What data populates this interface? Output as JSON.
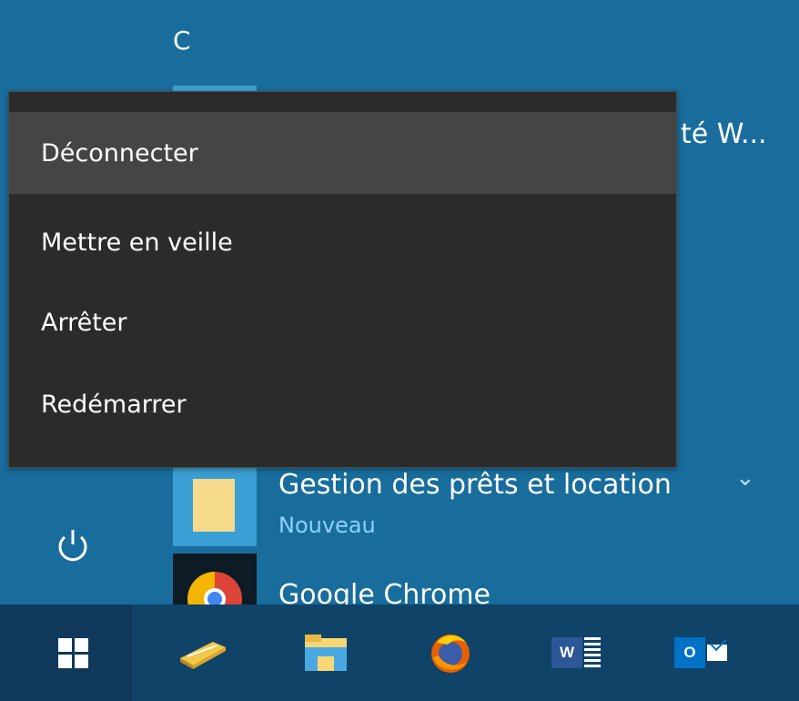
{
  "app_list": {
    "section_letter": "C",
    "truncated_item_text": "té W...",
    "apps": [
      {
        "name": "Gestion des prêts et location",
        "badge": "Nouveau",
        "icon": "document-icon",
        "expand_icon": "chevron-down-icon",
        "expand_glyph": "⌄"
      },
      {
        "name": "Google Chrome",
        "icon": "chrome-icon"
      }
    ]
  },
  "power_menu": {
    "items": [
      {
        "label": "Déconnecter",
        "state": "hover"
      },
      {
        "label": "Mettre en veille"
      },
      {
        "label": "Arrêter"
      },
      {
        "label": "Redémarrer"
      }
    ]
  },
  "sidebar": {
    "power_icon": "power-icon"
  },
  "taskbar": {
    "items": [
      {
        "name": "start",
        "icon": "windows-icon"
      },
      {
        "name": "scanner",
        "icon": "scanner-icon"
      },
      {
        "name": "file-explorer",
        "icon": "folder-icon"
      },
      {
        "name": "firefox",
        "icon": "firefox-icon"
      },
      {
        "name": "word",
        "icon": "word-icon",
        "letter": "W"
      },
      {
        "name": "outlook",
        "icon": "outlook-icon",
        "letter": "O"
      }
    ]
  },
  "colors": {
    "background": "#186d9c",
    "popup": "#2b2b2b",
    "popup_hover": "#454545",
    "taskbar": "#0f4368",
    "accent": "#3aa0cf",
    "badge_text": "#8ed1ff"
  }
}
